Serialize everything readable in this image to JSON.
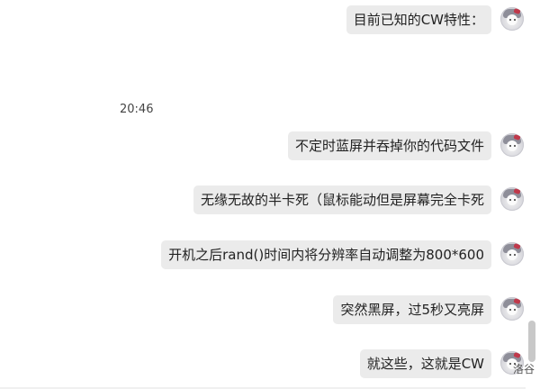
{
  "timestamp": "20:46",
  "messages": [
    {
      "text": "目前已知的CW特性："
    },
    {
      "text": "不定时蓝屏并吞掉你的代码文件"
    },
    {
      "text": "无缘无故的半卡死（鼠标能动但是屏幕完全卡死"
    },
    {
      "text": "开机之后rand()时间内将分辨率自动调整为800*600"
    },
    {
      "text": "突然黑屏，过5秒又亮屏"
    },
    {
      "text": "就这些，这就是CW"
    }
  ],
  "corner_text": "洛谷",
  "colors": {
    "bubble": "#ebebeb",
    "background": "#ffffff",
    "scroll_thumb": "#c8c8c8"
  },
  "icons": {
    "avatar": "user-avatar-icon"
  }
}
